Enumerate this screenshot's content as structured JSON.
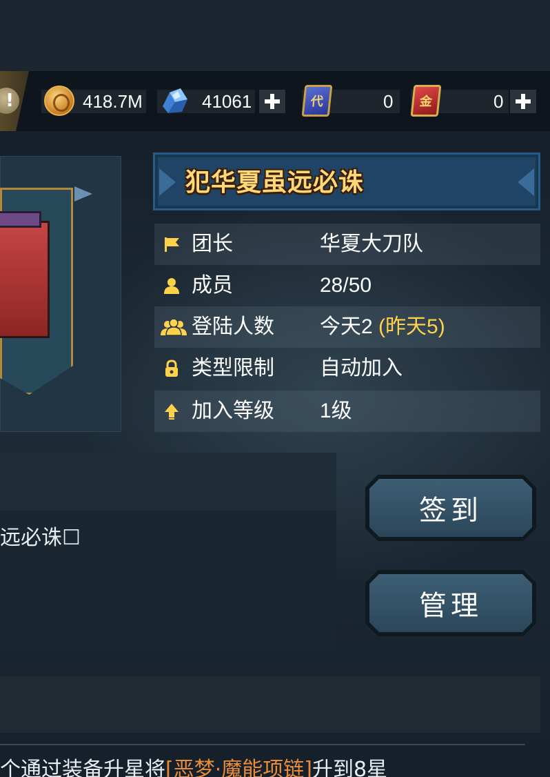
{
  "resources": {
    "gold": {
      "icon": "gold-coin-icon",
      "value": "418.7M"
    },
    "crystal": {
      "icon": "crystal-icon",
      "value": "41061"
    },
    "blue_card": {
      "icon": "blue-card-icon",
      "glyph": "代",
      "value": "0"
    },
    "gold_card": {
      "icon": "gold-card-icon",
      "glyph": "金",
      "value": "0"
    },
    "alert_glyph": "!"
  },
  "guild": {
    "name": "犯华夏虽远必诛",
    "rows": [
      {
        "icon": "flag-icon",
        "label": "团长",
        "value": "华夏大刀队"
      },
      {
        "icon": "person-icon",
        "label": "成员",
        "value": "28/50"
      },
      {
        "icon": "group-icon",
        "label": "登陆人数",
        "value": "今天2",
        "value_extra": " (昨天5)"
      },
      {
        "icon": "lock-icon",
        "label": "类型限制",
        "value": "自动加入"
      },
      {
        "icon": "arrow-up-icon",
        "label": "加入等级",
        "value": "1级"
      }
    ]
  },
  "notice": {
    "text": "远必诛☐"
  },
  "buttons": {
    "checkin": "签到",
    "manage": "管理"
  },
  "feed": {
    "prefix": "个通过装备升星将",
    "item": "[恶梦·魔能项链]",
    "suffix": "升到8星"
  },
  "colors": {
    "gold_text": "#ffd878",
    "highlight_yellow": "#ffd24a",
    "item_orange": "#e98c3a",
    "header_blue": "#1f4465"
  }
}
